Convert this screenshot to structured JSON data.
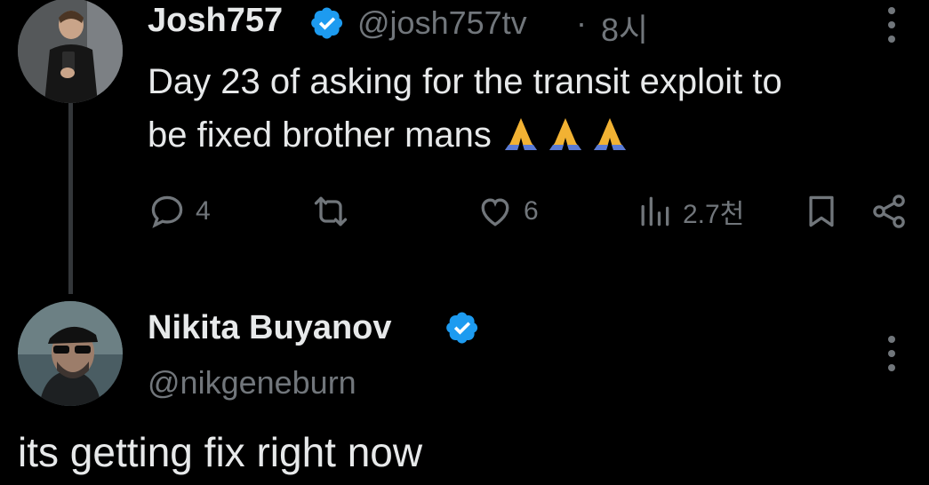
{
  "tweet": {
    "author_name": "Josh757",
    "author_handle": "@josh757tv",
    "separator": "·",
    "time": "8시",
    "text_line1": "Day 23 of asking for the transit exploit to",
    "text_line2": "be fixed brother mans",
    "emojis": [
      "folded-hands",
      "folded-hands",
      "folded-hands"
    ],
    "actions": {
      "reply_count": "4",
      "retweet_count": "",
      "like_count": "6",
      "views_count": "2.7천"
    }
  },
  "reply": {
    "author_name": "Nikita Buyanov",
    "author_handle": "@nikgeneburn",
    "text": "its getting fix right now"
  },
  "colors": {
    "background": "#000000",
    "text_primary": "#e7e9ea",
    "text_secondary": "#71767b",
    "verified_badge": "#1d9bf0",
    "thread_line": "#333639"
  },
  "icons": [
    "reply-icon",
    "retweet-icon",
    "like-icon",
    "views-icon",
    "bookmark-icon",
    "share-icon",
    "more-options-icon",
    "verified-badge-icon"
  ]
}
